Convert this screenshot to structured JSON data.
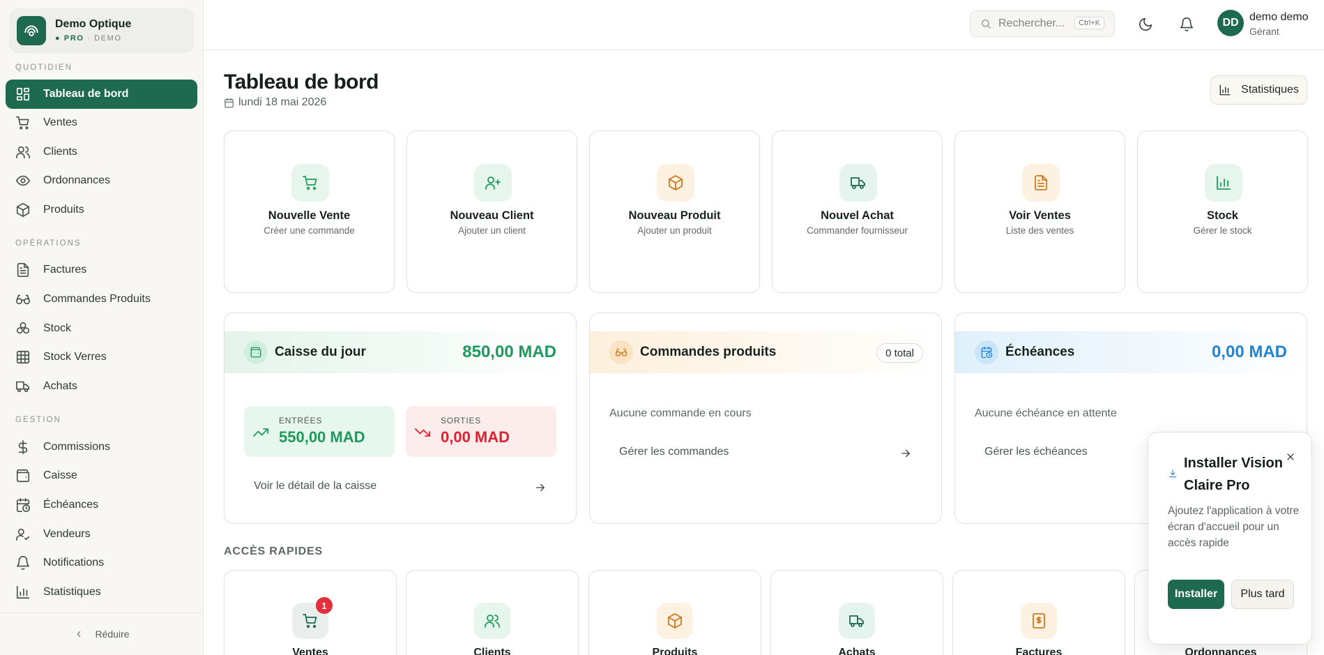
{
  "sidebar": {
    "brand_name": "Demo Optique",
    "brand_plan": "PRO",
    "brand_mode": "· DEMO",
    "sections": {
      "quotidien": "QUOTIDIEN",
      "operations": "OPÉRATIONS",
      "gestion": "GESTION"
    },
    "items": [
      {
        "label": "Tableau de bord",
        "icon": "dashboard-icon",
        "active": true
      },
      {
        "label": "Ventes",
        "icon": "cart-icon"
      },
      {
        "label": "Clients",
        "icon": "users-icon"
      },
      {
        "label": "Ordonnances",
        "icon": "eye-icon"
      },
      {
        "label": "Produits",
        "icon": "box-icon"
      },
      {
        "label": "Factures",
        "icon": "document-icon"
      },
      {
        "label": "Commandes Produits",
        "icon": "glasses-icon"
      },
      {
        "label": "Stock",
        "icon": "stack-icon"
      },
      {
        "label": "Stock Verres",
        "icon": "grid-icon"
      },
      {
        "label": "Achats",
        "icon": "truck-icon"
      },
      {
        "label": "Commissions",
        "icon": "dollar-icon"
      },
      {
        "label": "Caisse",
        "icon": "wallet-icon"
      },
      {
        "label": "Échéances",
        "icon": "calendar-clock-icon"
      },
      {
        "label": "Vendeurs",
        "icon": "user-check-icon"
      },
      {
        "label": "Notifications",
        "icon": "bell-icon"
      },
      {
        "label": "Statistiques",
        "icon": "bar-chart-icon"
      }
    ],
    "collapse_label": "Réduire"
  },
  "topbar": {
    "search_placeholder": "Rechercher...",
    "search_shortcut": "Ctrl+K",
    "avatar_initials": "DD",
    "user_name": "demo demo",
    "user_role": "Gérant"
  },
  "header": {
    "title": "Tableau de bord",
    "date": "lundi 18 mai 2026",
    "stats_button": "Statistiques"
  },
  "quick_actions": [
    {
      "title": "Nouvelle Vente",
      "subtitle": "Créer une commande",
      "icon": "cart-icon"
    },
    {
      "title": "Nouveau Client",
      "subtitle": "Ajouter un client",
      "icon": "user-plus-icon"
    },
    {
      "title": "Nouveau Produit",
      "subtitle": "Ajouter un produit",
      "icon": "box-icon"
    },
    {
      "title": "Nouvel Achat",
      "subtitle": "Commander fournisseur",
      "icon": "truck-icon"
    },
    {
      "title": "Voir Ventes",
      "subtitle": "Liste des ventes",
      "icon": "document-icon"
    },
    {
      "title": "Stock",
      "subtitle": "Gérer le stock",
      "icon": "bar-chart-icon"
    }
  ],
  "caisse": {
    "title": "Caisse du jour",
    "total": "850,00 MAD",
    "in_label": "ENTRÉES",
    "in_value": "550,00 MAD",
    "out_label": "SORTIES",
    "out_value": "0,00 MAD",
    "link": "Voir le détail de la caisse"
  },
  "commandes": {
    "title": "Commandes produits",
    "badge": "0 total",
    "empty": "Aucune commande en cours",
    "link": "Gérer les commandes"
  },
  "echeances": {
    "title": "Échéances",
    "total": "0,00 MAD",
    "empty": "Aucune échéance en attente",
    "link": "Gérer les échéances"
  },
  "acces_rapides": {
    "title": "ACCÈS RAPIDES",
    "items": [
      {
        "label": "Ventes",
        "badge": "1",
        "icon": "cart-icon"
      },
      {
        "label": "Clients",
        "icon": "users-icon"
      },
      {
        "label": "Produits",
        "icon": "box-icon"
      },
      {
        "label": "Achats",
        "icon": "truck-icon"
      },
      {
        "label": "Factures",
        "icon": "invoice-icon"
      },
      {
        "label": "Ordonnances",
        "icon": "eye-icon"
      }
    ]
  },
  "install_popup": {
    "title": "Installer Vision Claire Pro",
    "description": "Ajoutez l'application à votre écran d'accueil pour un accès rapide",
    "install_button": "Installer",
    "later_button": "Plus tard"
  },
  "colors": {
    "primary": "#1e6a50",
    "positive": "#1e9a5c",
    "negative": "#e0202d",
    "info": "#1f84d6",
    "orange": "#d2761a"
  }
}
